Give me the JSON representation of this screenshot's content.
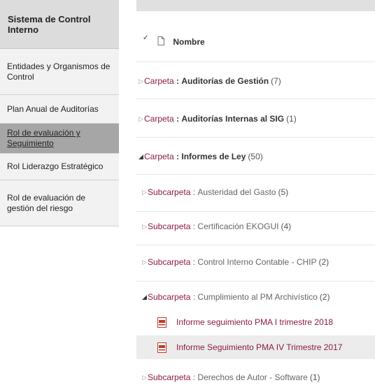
{
  "sidebar": {
    "title": "Sistema de Control Interno",
    "items": [
      {
        "label": "Entidades y Organismos de Control",
        "active": false
      },
      {
        "label": "Plan Anual de Auditorías",
        "active": false
      },
      {
        "label": "Rol de evaluación y Seguimiento",
        "active": true
      },
      {
        "label": "Rol Liderazgo Estratégico",
        "active": false
      },
      {
        "label": "Rol de evaluación de gestión del riesgo",
        "active": false
      }
    ]
  },
  "list": {
    "header": {
      "checkmark": "✓",
      "label": "Nombre"
    },
    "folder_keyword": "Carpeta",
    "subfolder_keyword": "Subcarpeta",
    "folders": [
      {
        "name": "Auditorías de Gestión",
        "count": "(7)"
      },
      {
        "name": "Auditorías Internas al SIG",
        "count": "(1)"
      },
      {
        "name": "Informes de Ley",
        "count": "(50)"
      }
    ],
    "subfolders": [
      {
        "name": "Austeridad del Gasto",
        "count": "(5)"
      },
      {
        "name": "Certificación EKOGUI",
        "count": "(4)"
      },
      {
        "name": "Control Interno Contable - CHIP",
        "count": "(2)"
      },
      {
        "name": "Cumplimiento al PM Archivístico",
        "count": "(2)"
      },
      {
        "name": "Derechos de Autor - Software",
        "count": "(1)"
      }
    ],
    "files": [
      {
        "name": "Informe seguimiento PMA I trimestre 2018",
        "icon": "pdf-file-icon"
      },
      {
        "name": "Informe Seguimiento PMA IV Trimestre 2017",
        "icon": "pdf-file-icon"
      }
    ]
  },
  "colors": {
    "link": "#8c1d40",
    "active_nav": "#a6a6a6",
    "header_bg": "#dcdcdc"
  }
}
